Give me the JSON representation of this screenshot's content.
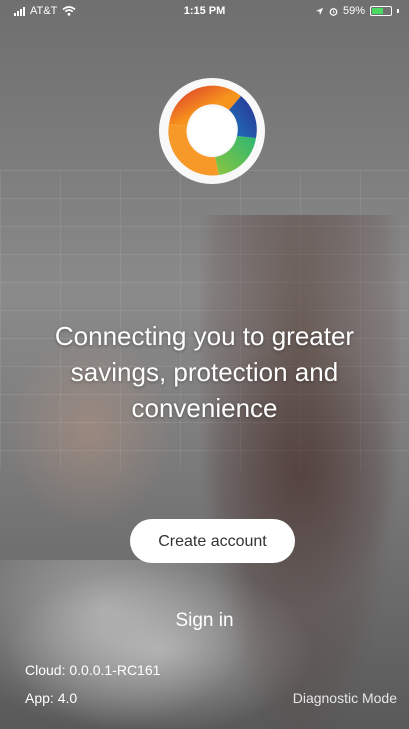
{
  "status_bar": {
    "carrier": "AT&T",
    "time": "1:15 PM",
    "battery_percent": "59%",
    "battery_level": 0.59,
    "icons": [
      "signal-icon",
      "wifi-icon",
      "location-icon",
      "alarm-icon",
      "battery-icon"
    ]
  },
  "brand": {
    "logo_icon": "ring-logo-icon",
    "colors": [
      "#d8312f",
      "#f7941d",
      "#8dc63f",
      "#2bb673",
      "#1b75bc",
      "#2e3192"
    ]
  },
  "main": {
    "tagline": "Connecting you to greater savings, protection and convenience",
    "create_account_label": "Create account",
    "sign_in_label": "Sign in"
  },
  "footer": {
    "cloud_version": "Cloud: 0.0.0.1-RC161",
    "app_version": "App: 4.0",
    "diagnostic_label": "Diagnostic Mode"
  }
}
